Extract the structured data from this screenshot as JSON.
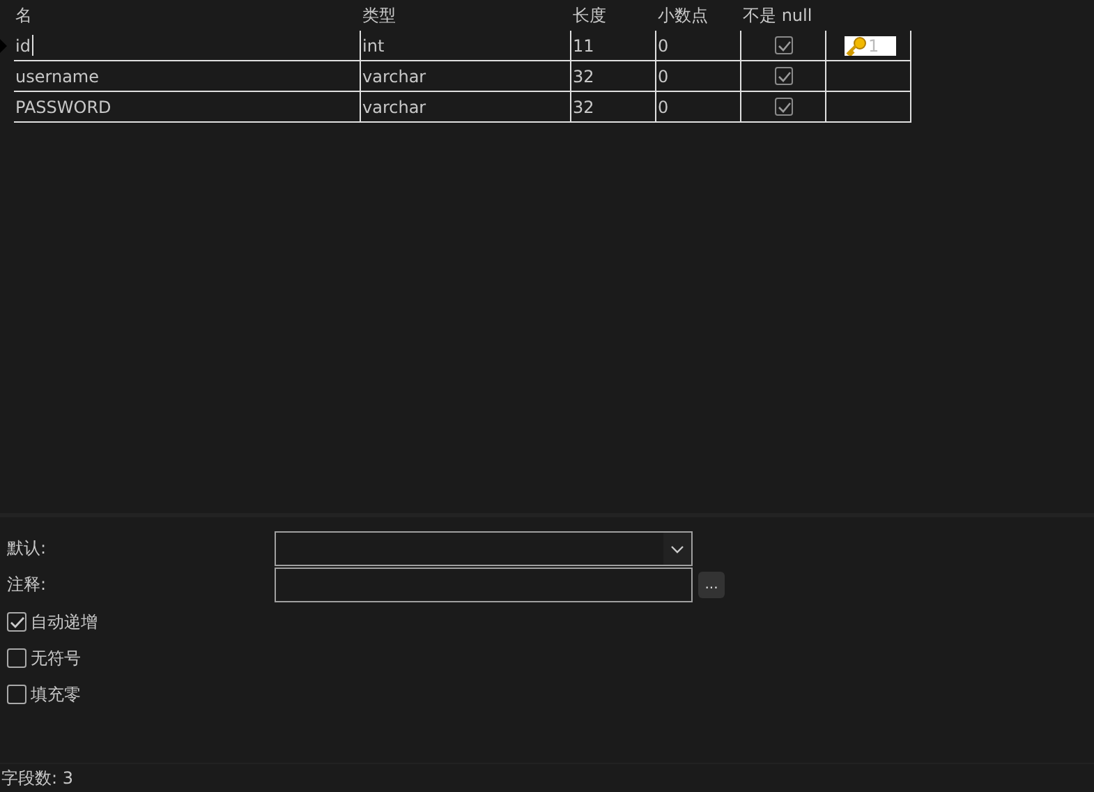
{
  "table": {
    "columns": [
      "名",
      "类型",
      "长度",
      "小数点",
      "不是 null"
    ],
    "rows": [
      {
        "current": true,
        "name": "id",
        "type": "int",
        "length": "11",
        "decimals": "0",
        "not_null": true,
        "key": "1"
      },
      {
        "current": false,
        "name": "username",
        "type": "varchar",
        "length": "32",
        "decimals": "0",
        "not_null": true
      },
      {
        "current": false,
        "name": "PASSWORD",
        "type": "varchar",
        "length": "32",
        "decimals": "0",
        "not_null": true
      }
    ]
  },
  "properties": {
    "fields": [
      {
        "kind": "dropdown",
        "label": "默认:"
      },
      {
        "kind": "text",
        "label": "注释:",
        "button": "..."
      }
    ],
    "checkboxes": [
      {
        "label": "自动递增",
        "checked": true
      },
      {
        "label": "无符号",
        "checked": false
      },
      {
        "label": "填充零",
        "checked": false
      }
    ]
  },
  "status_bar": "字段数: 3"
}
